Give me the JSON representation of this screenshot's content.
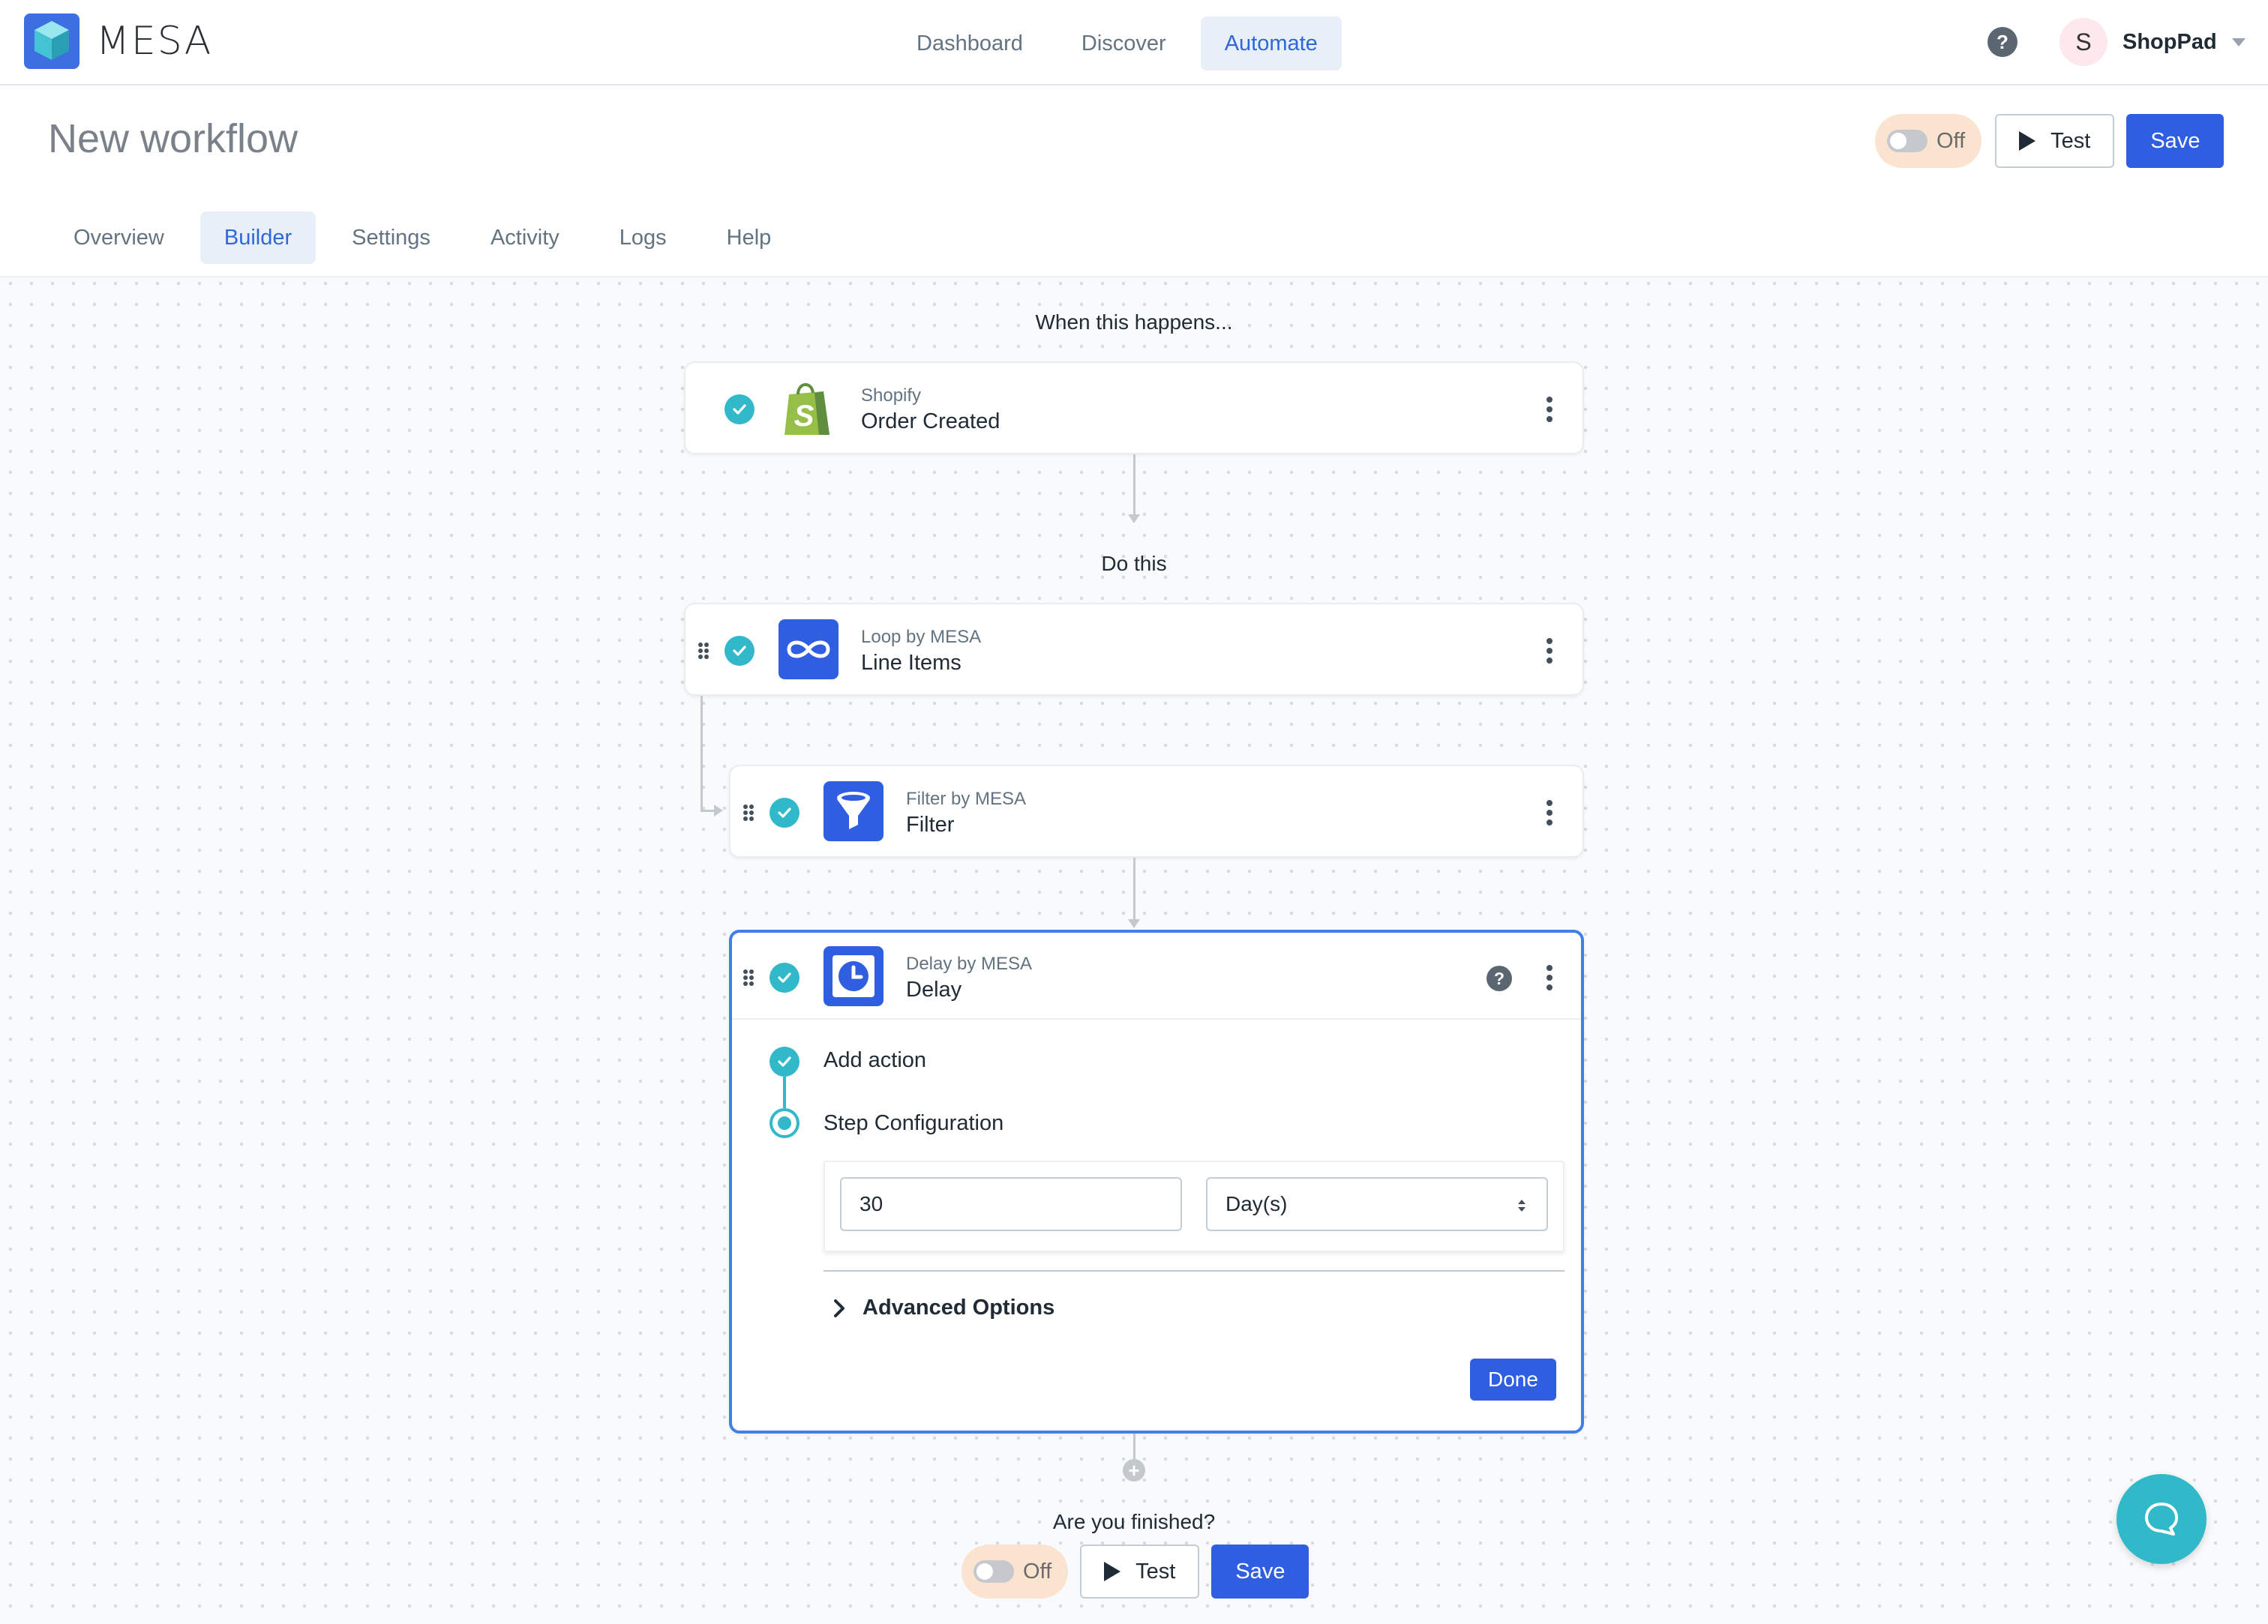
{
  "brand": {
    "name": "MESA"
  },
  "topnav": {
    "items": [
      {
        "label": "Dashboard",
        "active": false
      },
      {
        "label": "Discover",
        "active": false
      },
      {
        "label": "Automate",
        "active": true
      }
    ],
    "help_icon": "question-circle-icon",
    "user": {
      "initial": "S",
      "name": "ShopPad"
    }
  },
  "header": {
    "title": "New workflow",
    "toggle_label": "Off",
    "test_label": "Test",
    "save_label": "Save",
    "tabs": [
      {
        "label": "Overview",
        "active": false
      },
      {
        "label": "Builder",
        "active": true
      },
      {
        "label": "Settings",
        "active": false
      },
      {
        "label": "Activity",
        "active": false
      },
      {
        "label": "Logs",
        "active": false
      },
      {
        "label": "Help",
        "active": false
      }
    ]
  },
  "workflow": {
    "trigger_heading": "When this happens...",
    "trigger": {
      "app": "Shopify",
      "name": "Order Created",
      "icon": "shopify-bag-icon"
    },
    "actions_heading": "Do this",
    "steps": [
      {
        "app": "Loop by MESA",
        "name": "Line Items",
        "icon": "infinity-icon"
      },
      {
        "app": "Filter by MESA",
        "name": "Filter",
        "icon": "funnel-icon"
      },
      {
        "app": "Delay by MESA",
        "name": "Delay",
        "icon": "clock-icon"
      }
    ],
    "delay_config": {
      "stepper": [
        "Add action",
        "Step Configuration"
      ],
      "amount": "30",
      "unit": "Day(s)",
      "advanced_label": "Advanced Options",
      "done_label": "Done"
    },
    "finish_heading": "Are you finished?",
    "finish_toggle_label": "Off",
    "finish_test_label": "Test",
    "finish_save_label": "Save"
  },
  "colors": {
    "primary": "#2f5ee0",
    "teal": "#31b9c9",
    "active_tab_bg": "#e9eff8",
    "toggle_bg": "#fbe4cf"
  }
}
